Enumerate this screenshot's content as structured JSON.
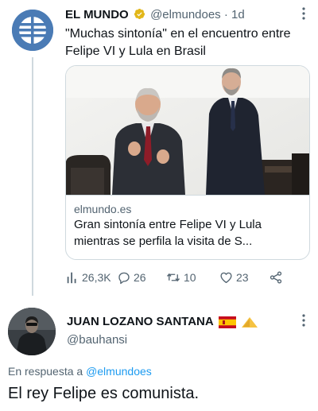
{
  "tweet1": {
    "author_name": "EL MUNDO",
    "handle": "@elmundoes",
    "separator": "·",
    "time": "1d",
    "text": "\"Muchas sintonía\" en el encuentro entre Felipe VI y Lula en Brasil",
    "card": {
      "domain": "elmundo.es",
      "title": "Gran sintonía entre Felipe VI y Lula mientras se perfila la visita de S..."
    },
    "actions": {
      "views": "26,3K",
      "replies": "26",
      "retweets": "10",
      "likes": "23"
    }
  },
  "tweet2": {
    "author_name": "JUAN LOZANO SANTANA",
    "handle": "@bauhansi",
    "reply_prefix": "En respuesta a",
    "reply_handle": "@elmundoes",
    "text": "El rey Felipe es comunista."
  },
  "colors": {
    "link": "#1d9bf0",
    "secondary_text": "#536471",
    "verified_badge": "#e2b719"
  },
  "icons": [
    "more-icon",
    "verified-badge-icon",
    "views-icon",
    "reply-icon",
    "retweet-icon",
    "like-icon",
    "share-icon",
    "spain-flag-icon",
    "ruler-triangle-icon"
  ]
}
